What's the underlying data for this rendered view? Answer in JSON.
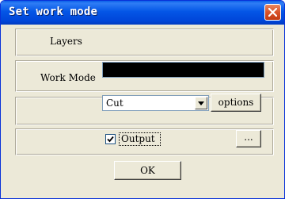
{
  "window": {
    "title": "Set work mode",
    "close_icon": "close-icon"
  },
  "layers": {
    "label": "Layers",
    "value": ""
  },
  "work_mode": {
    "label": "Work Mode",
    "selected": "Cut",
    "options_button": "options"
  },
  "output": {
    "checkbox_label": "Output",
    "checked": true,
    "browse_button": "..."
  },
  "ok_button": "OK",
  "colors": {
    "titlebar": "#0054e3",
    "close": "#d9532a",
    "face": "#ece9d8"
  }
}
